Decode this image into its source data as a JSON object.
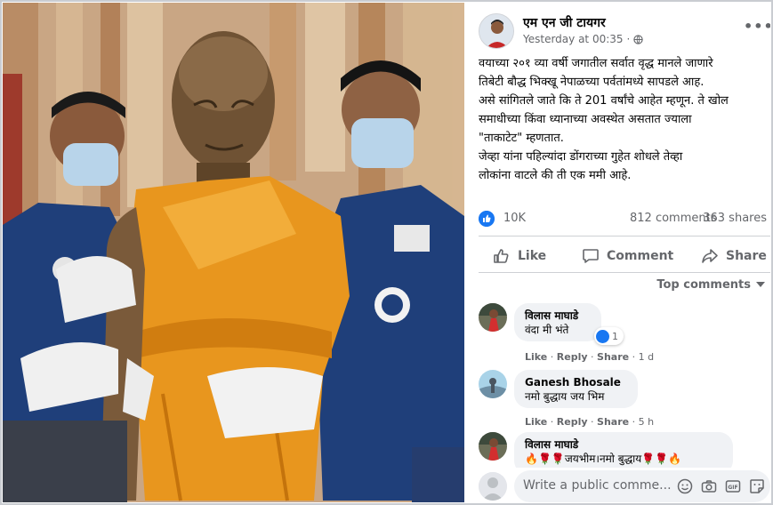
{
  "post": {
    "author": "एम एन जी टायगर",
    "timestamp": "Yesterday at 00:35",
    "privacy_icon": "globe-icon",
    "more_icon": "more-options-icon",
    "text": "वयाच्या २०१ व्या वर्षी जगातील सर्वात वृद्ध मानले जाणारे\nतिबेटी बौद्ध भिक्खू नेपाळच्या पर्वतांमध्ये सापडले आह.\nअसे सांगितले जाते कि ते 201 वर्षांचे आहेत म्हणून. ते खोल\nसमाधीच्या किंवा ध्यानाच्या अवस्थेत असतात ज्याला\n\"ताकाटेट\" म्हणतात.\nजेव्हा यांना पहिल्यांदा डोंगराच्या गुहेत शोधले तेव्हा\nलोकांना वाटले की ती एक ममी आहे."
  },
  "stats": {
    "reactions": "10K",
    "comments": "812 comments",
    "shares": "363 shares"
  },
  "actions": {
    "like": "Like",
    "comment": "Comment",
    "share": "Share"
  },
  "comments_filter": "Top comments",
  "comments": [
    {
      "name": "विलास माघाडे",
      "text": "वंदा मी भंते",
      "reaction_count": "1",
      "like": "Like",
      "reply": "Reply",
      "share": "Share",
      "age": "1 d"
    },
    {
      "name": "Ganesh Bhosale",
      "text": "नमो बुद्धाय जय भिम",
      "like": "Like",
      "reply": "Reply",
      "share": "Share",
      "age": "5 h"
    },
    {
      "name": "विलास माघाडे",
      "text": "🔥🌹🌹जयभीम।नमो बुद्धाय🌹🌹🔥"
    }
  ],
  "composer": {
    "placeholder": "Write a public comme...",
    "icons": [
      "emoji-icon",
      "camera-icon",
      "gif-icon",
      "sticker-icon"
    ]
  },
  "colors": {
    "facebook_blue": "#1877f2",
    "secondary_text": "#65676b",
    "bubble_bg": "#f0f2f5",
    "robe_orange": "#e8961e"
  }
}
